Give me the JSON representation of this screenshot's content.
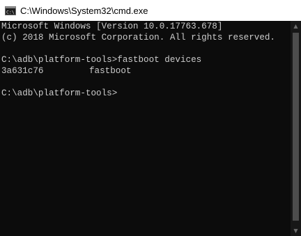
{
  "window": {
    "title": "C:\\Windows\\System32\\cmd.exe",
    "icon": "cmd-icon"
  },
  "console": {
    "header_line1": "Microsoft Windows [Version 10.0.17763.678]",
    "header_line2": "(c) 2018 Microsoft Corporation. All rights reserved.",
    "command_line": "C:\\adb\\platform-tools>fastboot devices",
    "device": {
      "id": "3a631c76",
      "mode": "fastboot"
    },
    "prompt": "C:\\adb\\platform-tools>"
  },
  "colors": {
    "background": "#0c0c0c",
    "text": "#cccccc",
    "titlebar": "#ffffff"
  },
  "scrollbar": {
    "up_icon": "scroll-up-arrow-icon",
    "down_icon": "scroll-down-arrow-icon"
  }
}
